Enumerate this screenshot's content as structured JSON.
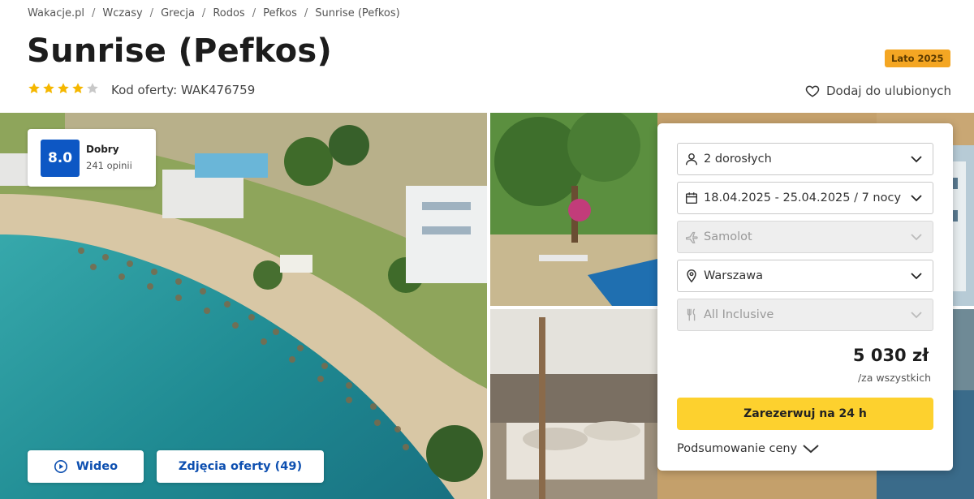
{
  "breadcrumb": [
    "Wakacje.pl",
    "Wczasy",
    "Grecja",
    "Rodos",
    "Pefkos",
    "Sunrise (Pefkos)"
  ],
  "hotel": {
    "name": "Sunrise (Pefkos)",
    "stars": 4,
    "stars_max": 5,
    "offer_code": "Kod oferty: WAK476759"
  },
  "season_badge": "Lato 2025",
  "favorite_label": "Dodaj do ulubionych",
  "rating": {
    "score": "8.0",
    "label": "Dobry",
    "count": "241 opinii"
  },
  "gallery_buttons": {
    "video": "Wideo",
    "photos": "Zdjęcia oferty (49)"
  },
  "booking": {
    "guests": "2 dorosłych",
    "dates": "18.04.2025 - 25.04.2025 / 7 nocy",
    "transport": "Samolot",
    "departure": "Warszawa",
    "board": "All Inclusive",
    "price": "5 030 zł",
    "price_note": "/za wszystkich",
    "book_label": "Zarezerwuj na 24 h",
    "summary_label": "Podsumowanie ceny"
  },
  "colors": {
    "rating_blue": "#0d57c4",
    "book_yellow": "#fdd12e",
    "season_orange": "#f4a623",
    "star_gold": "#f5b700",
    "link_blue": "#0d4fb0"
  }
}
